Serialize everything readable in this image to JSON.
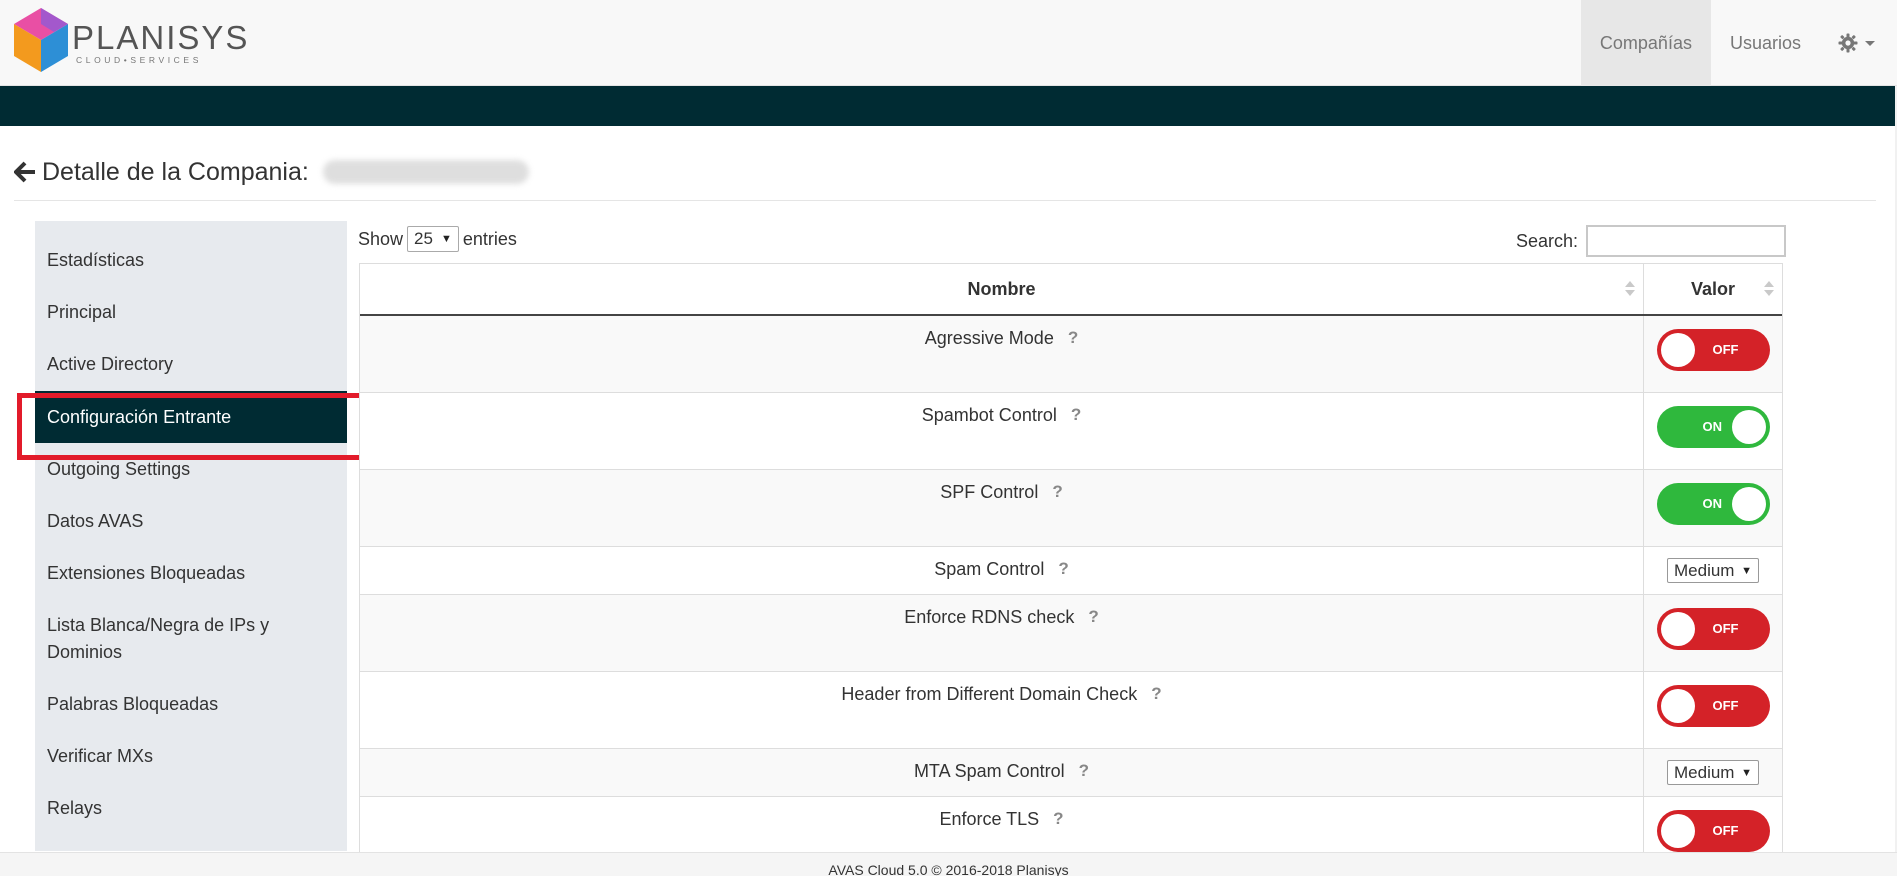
{
  "brand": {
    "name": "PLANISYS",
    "tagline": "CLOUD•SERVICES"
  },
  "topnav": {
    "companies": "Compañías",
    "users": "Usuarios"
  },
  "page": {
    "title": "Detalle de la Compania:"
  },
  "sidebar": {
    "items": [
      {
        "label": "Estadísticas"
      },
      {
        "label": "Principal"
      },
      {
        "label": "Active Directory"
      },
      {
        "label": "Configuración Entrante"
      },
      {
        "label": "Outgoing Settings"
      },
      {
        "label": "Datos AVAS"
      },
      {
        "label": "Extensiones Bloqueadas"
      },
      {
        "label": "Lista Blanca/Negra de IPs y Dominios"
      },
      {
        "label": "Palabras Bloqueadas"
      },
      {
        "label": "Verificar MXs"
      },
      {
        "label": "Relays"
      }
    ],
    "active_index": 3
  },
  "table_controls": {
    "show_label": "Show",
    "entries_value": "25",
    "entries_label": "entries",
    "search_label": "Search:",
    "search_value": ""
  },
  "table": {
    "columns": [
      "Nombre",
      "Valor"
    ],
    "help_glyph": "?",
    "rows": [
      {
        "name": "Agressive Mode",
        "type": "toggle",
        "state": "OFF"
      },
      {
        "name": "Spambot Control",
        "type": "toggle",
        "state": "ON"
      },
      {
        "name": "SPF Control",
        "type": "toggle",
        "state": "ON"
      },
      {
        "name": "Spam Control",
        "type": "select",
        "value": "Medium"
      },
      {
        "name": "Enforce RDNS check",
        "type": "toggle",
        "state": "OFF"
      },
      {
        "name": "Header from Different Domain Check",
        "type": "toggle",
        "state": "OFF"
      },
      {
        "name": "MTA Spam Control",
        "type": "select",
        "value": "Medium"
      },
      {
        "name": "Enforce TLS",
        "type": "toggle",
        "state": "OFF"
      }
    ]
  },
  "footer": {
    "text": "AVAS Cloud 5.0 © 2016-2018 Planisys"
  },
  "colors": {
    "navbar_band": "#002b33",
    "sidebar_bg": "#e7eaee",
    "sidebar_active": "#002b33",
    "highlight_box": "#e21b2a",
    "toggle_on": "#2fb83d",
    "toggle_off": "#d42228"
  },
  "icons": {
    "back": "arrow-left-icon",
    "settings": "gear-icon",
    "help": "question-mark-icon",
    "sort": "sort-icon"
  }
}
